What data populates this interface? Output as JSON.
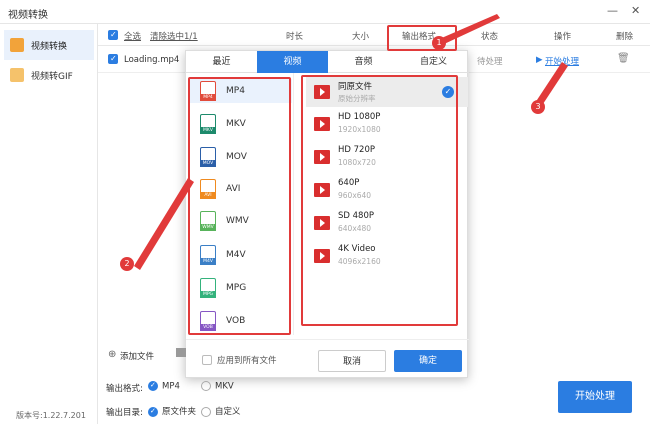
{
  "window": {
    "title": "视频转换",
    "min": "—",
    "close": "✕"
  },
  "sidebar": {
    "items": [
      {
        "label": "视频转换",
        "icon": "video-convert-icon"
      },
      {
        "label": "视频转GIF",
        "icon": "gif-icon"
      }
    ],
    "version": "版本号:1.22.7.201"
  },
  "table": {
    "select_all": "全选",
    "clear_selected": "清除选中1/1",
    "headers": {
      "duration": "时长",
      "size": "大小",
      "output_format": "输出格式",
      "status": "状态",
      "operation": "操作",
      "delete": "删除"
    },
    "rows": [
      {
        "name": "Loading.mp4",
        "status": "待处理",
        "action": "开始处理"
      }
    ]
  },
  "popup": {
    "tabs": [
      "最近",
      "视频",
      "音频",
      "自定义"
    ],
    "active_tab": "视频",
    "formats": [
      {
        "name": "MP4",
        "color": "#e14b3b"
      },
      {
        "name": "MKV",
        "color": "#1d8a6c"
      },
      {
        "name": "MOV",
        "color": "#2b5fa8"
      },
      {
        "name": "AVI",
        "color": "#ef8a1f"
      },
      {
        "name": "WMV",
        "color": "#58b35b"
      },
      {
        "name": "M4V",
        "color": "#3b7fc6"
      },
      {
        "name": "MPG",
        "color": "#34b27c"
      },
      {
        "name": "VOB",
        "color": "#8657c4"
      }
    ],
    "resolutions": [
      {
        "name": "同原文件",
        "sub": "原始分辨率",
        "selected": true
      },
      {
        "name": "HD 1080P",
        "sub": "1920x1080"
      },
      {
        "name": "HD 720P",
        "sub": "1080x720"
      },
      {
        "name": "640P",
        "sub": "960x640"
      },
      {
        "name": "SD 480P",
        "sub": "640x480"
      },
      {
        "name": "4K Video",
        "sub": "4096x2160"
      }
    ],
    "apply_all": "应用到所有文件",
    "cancel": "取消",
    "confirm": "确定"
  },
  "bottom": {
    "add_file": "添加文件",
    "output_format_label": "输出格式:",
    "format_opt1": "MP4",
    "format_opt2": "MKV",
    "output_dir_label": "输出目录:",
    "dir_opt1": "原文件夹",
    "dir_opt2": "自定义",
    "start_button": "开始处理"
  },
  "annotations": [
    "1",
    "2",
    "3"
  ],
  "colors": {
    "accent": "#2b7de1",
    "annotation_red": "#e13a3a"
  }
}
